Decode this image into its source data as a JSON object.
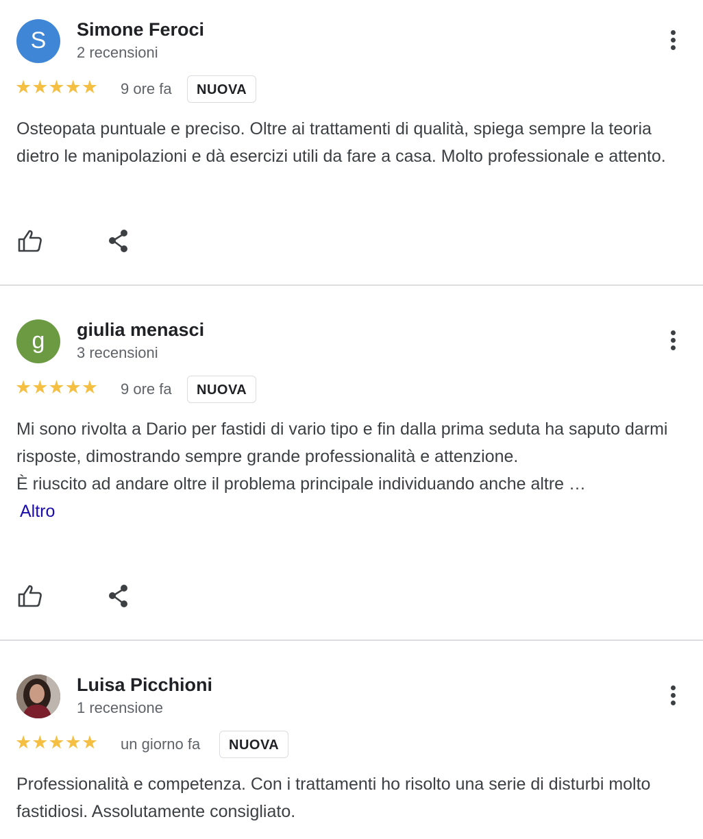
{
  "reviews": [
    {
      "avatar_letter": "S",
      "avatar_color": "#3f86d6",
      "name": "Simone Feroci",
      "count": "2 recensioni",
      "stars": "★★★★★",
      "time": "9 ore fa",
      "badge": "NUOVA",
      "text": [
        "Osteopata puntuale e preciso. Oltre ai trattamenti di qualità, spiega sempre la teoria dietro le manipolazioni e dà esercizi utili da fare a casa. Molto professionale e attento."
      ]
    },
    {
      "avatar_letter": "g",
      "avatar_color": "#6b9a43",
      "name": "giulia menasci",
      "count": "3 recensioni",
      "stars": "★★★★★",
      "time": "9 ore fa",
      "badge": "NUOVA",
      "text": [
        "Mi sono rivolta a Dario per fastidi di vario tipo e fin dalla prima seduta ha saputo darmi risposte, dimostrando sempre grande professionalità e attenzione.",
        "È riuscito ad andare oltre il problema principale individuando anche altre …"
      ],
      "more_label": "Altro"
    },
    {
      "name": "Luisa Picchioni",
      "count": "1 recensione",
      "stars": "★★★★★",
      "time": "un giorno fa",
      "badge": "NUOVA",
      "text": [
        "Professionalità e competenza. Con i trattamenti ho risolto una serie di disturbi molto fastidiosi. Assolutamente consigliato."
      ]
    }
  ],
  "colors": {
    "star": "#f4bf42",
    "link": "#1a0dab",
    "divider": "#dadce0"
  },
  "icons": {
    "like": "thumbs-up-icon",
    "share": "share-icon",
    "menu": "more-vert-icon"
  }
}
